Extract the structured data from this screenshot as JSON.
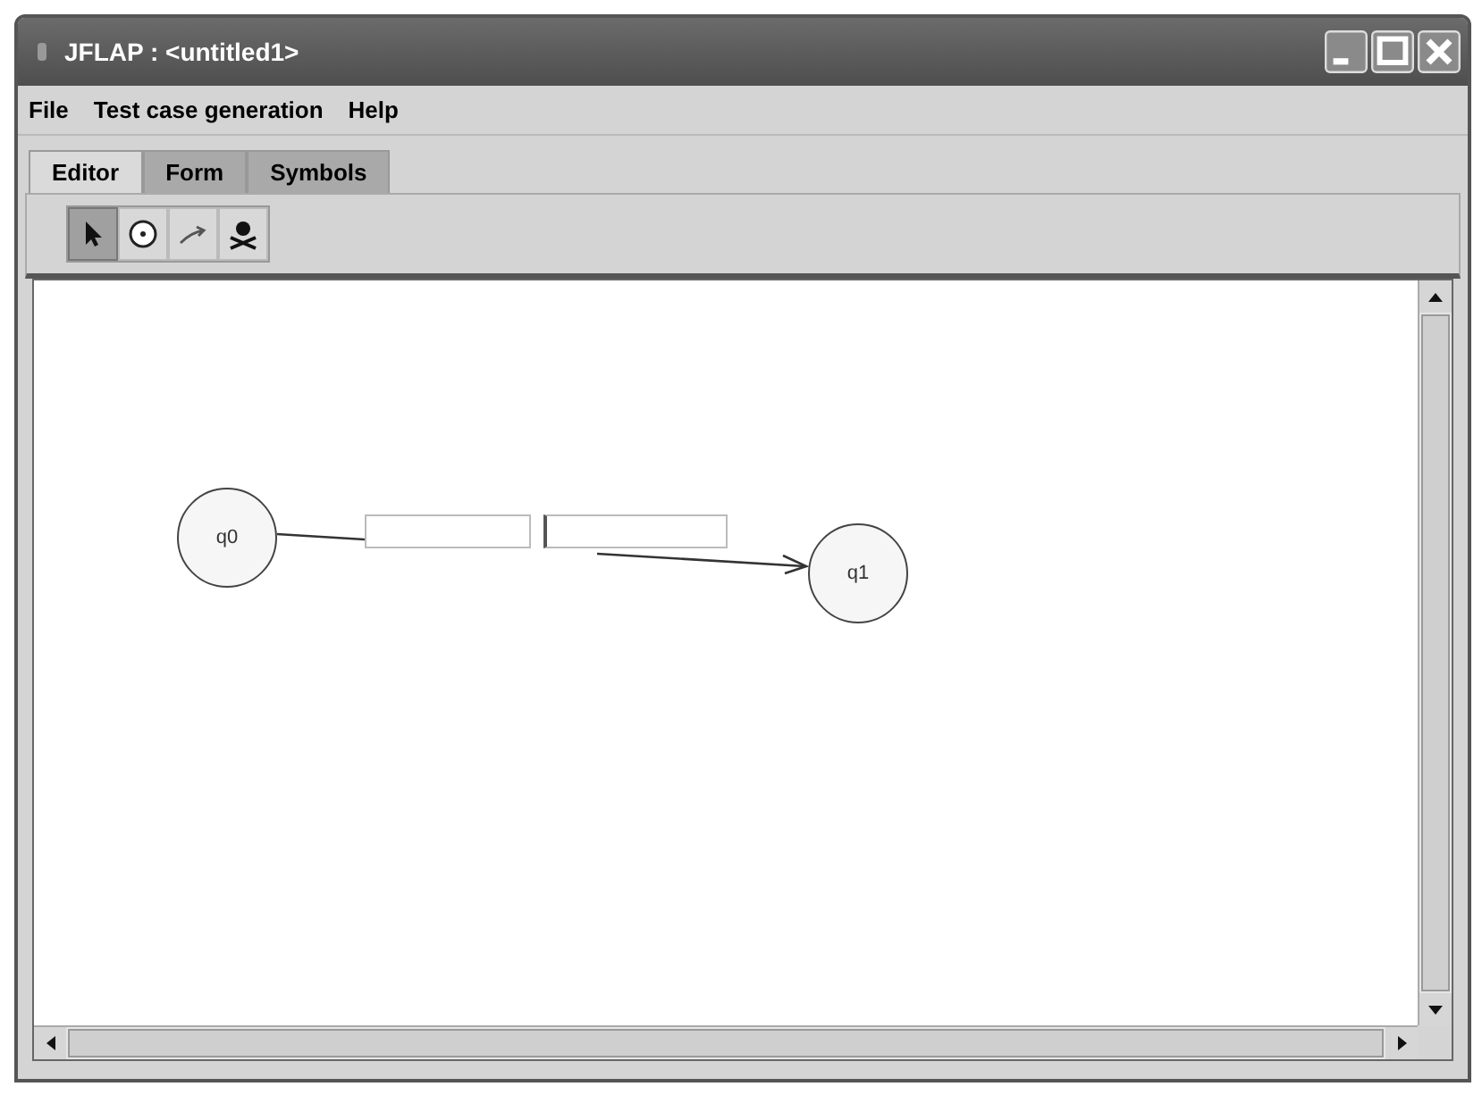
{
  "window": {
    "title": "JFLAP : <untitled1>"
  },
  "menu": [
    "File",
    "Test case generation",
    "Help"
  ],
  "tabs": [
    {
      "label": "Editor",
      "selected": true
    },
    {
      "label": "Form",
      "selected": false
    },
    {
      "label": "Symbols",
      "selected": false
    }
  ],
  "tools": [
    {
      "kind": "pointer",
      "selected": true
    },
    {
      "kind": "state",
      "selected": false
    },
    {
      "kind": "transition",
      "selected": false
    },
    {
      "kind": "delete",
      "selected": false
    }
  ],
  "states": [
    {
      "label": "q0"
    },
    {
      "label": "q1"
    }
  ]
}
